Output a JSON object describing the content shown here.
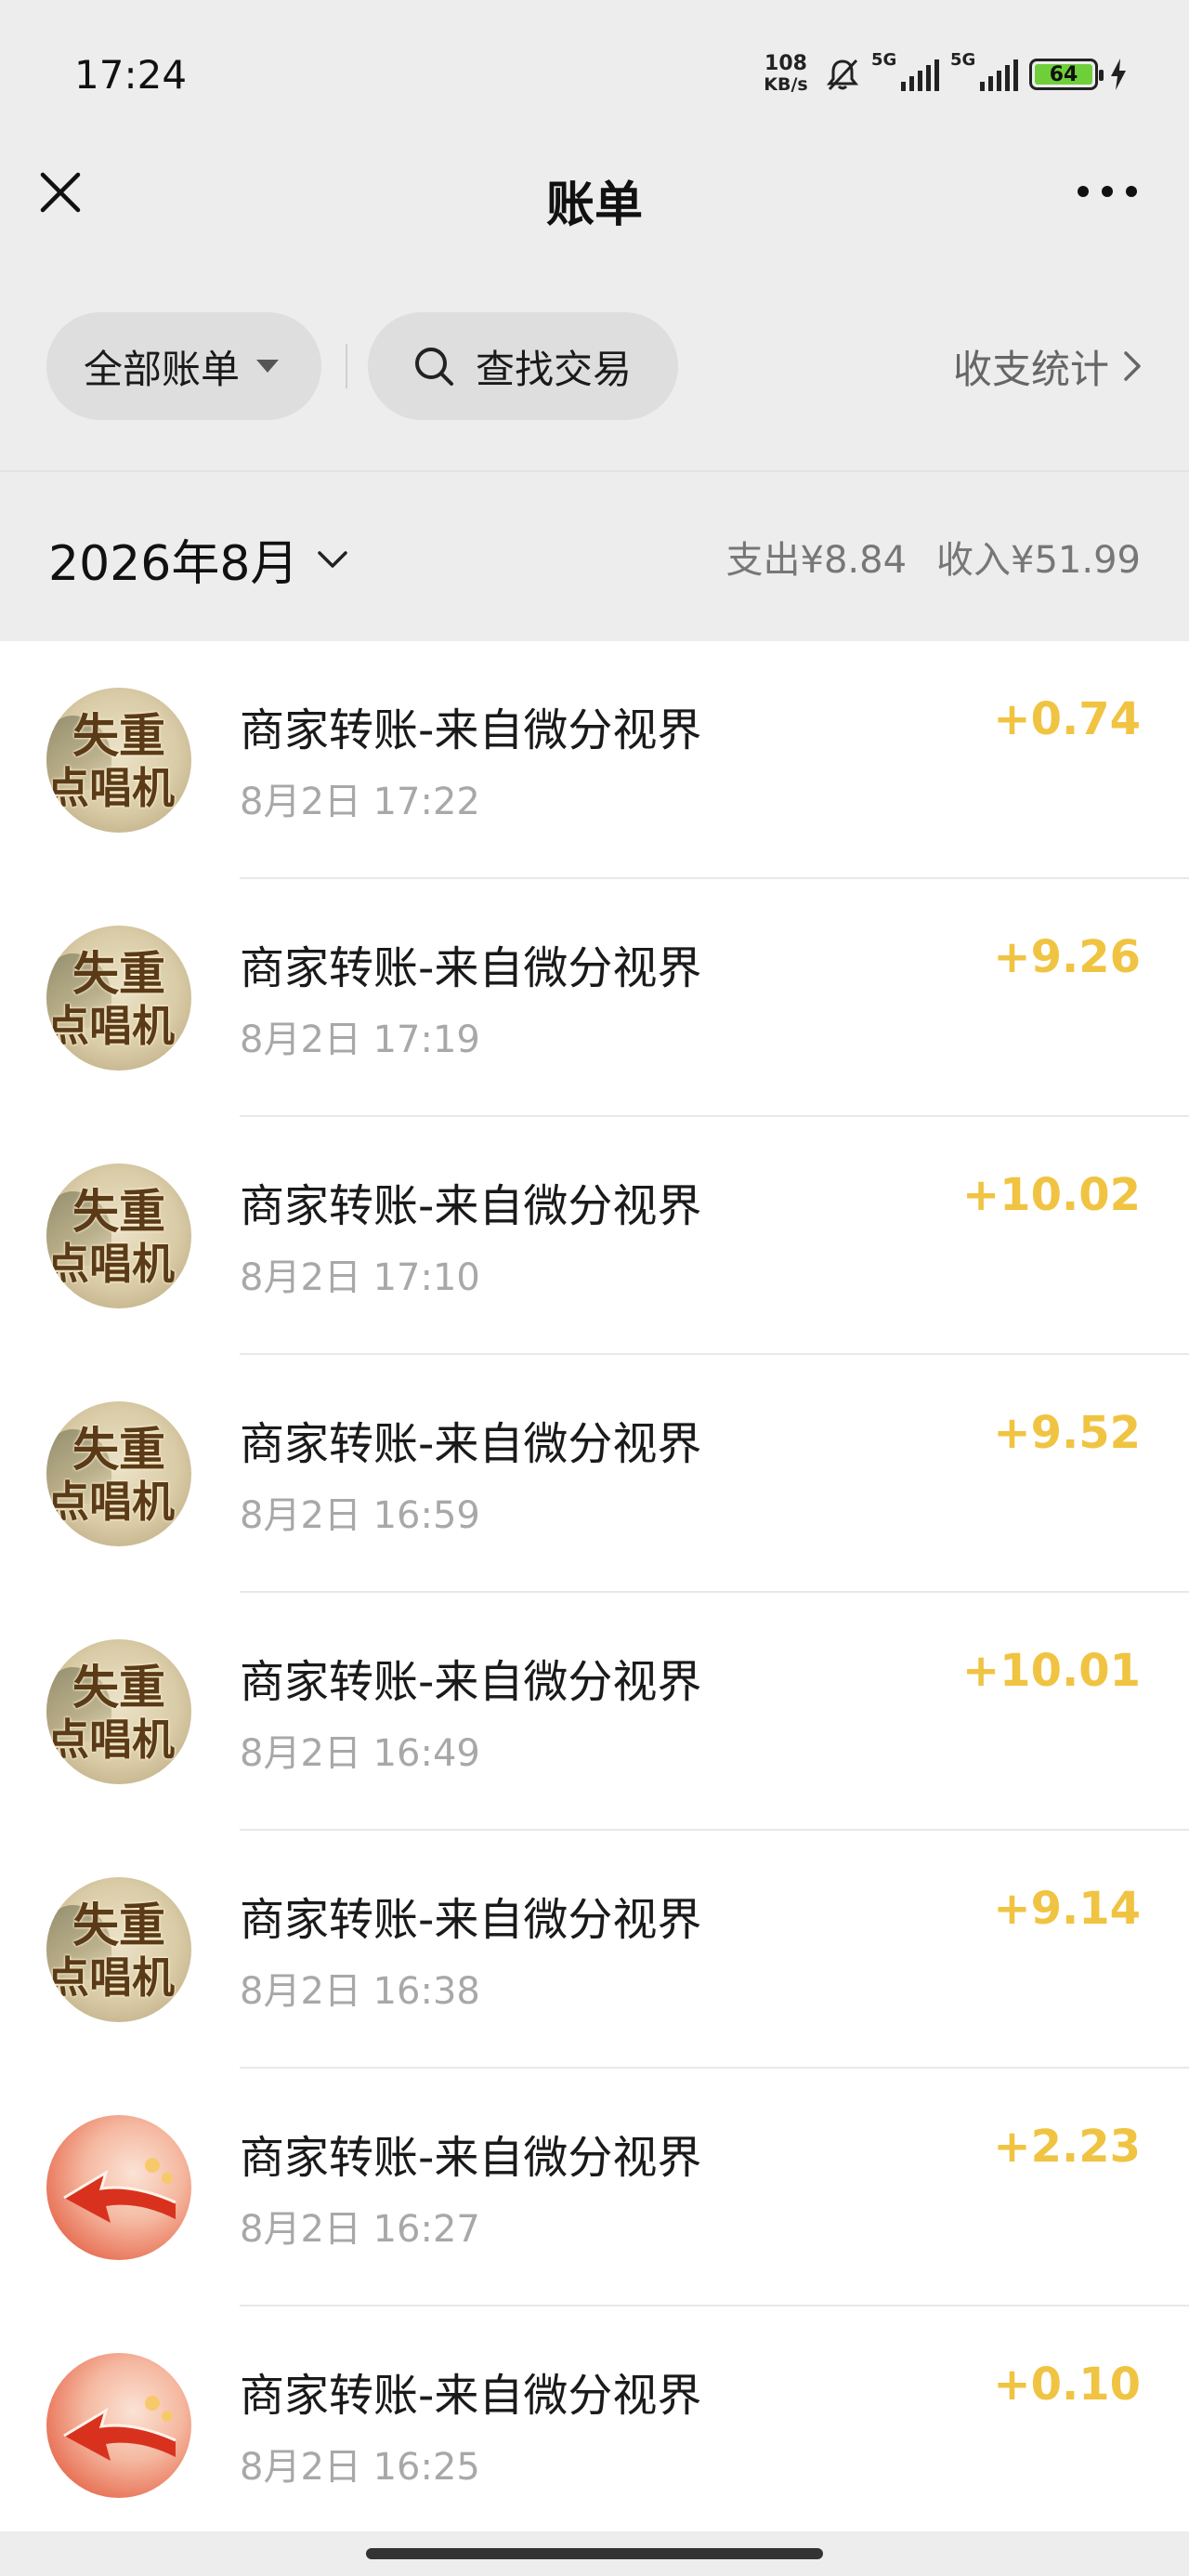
{
  "status_bar": {
    "time": "17:24",
    "net_speed_value": "108",
    "net_speed_unit": "KB/s",
    "sim1_label": "5G",
    "sim2_label": "5G",
    "battery_level": "64",
    "icons": [
      "bell-off-icon",
      "signal-icon",
      "battery-icon",
      "charging-bolt-icon"
    ]
  },
  "header": {
    "title": "账单",
    "close_icon": "close-icon",
    "more_icon": "more-icon"
  },
  "filters": {
    "all_bills_label": "全部账单",
    "search_label": "查找交易",
    "stats_label": "收支统计"
  },
  "month": {
    "label": "2026年8月",
    "expense": "支出¥8.84",
    "income": "收入¥51.99"
  },
  "transactions": [
    {
      "title": "商家转账-来自微分视界",
      "time": "8月2日 17:22",
      "amount": "+0.74",
      "avatar": "poster",
      "avatar_text_1": "失重",
      "avatar_text_2": "点唱机"
    },
    {
      "title": "商家转账-来自微分视界",
      "time": "8月2日 17:19",
      "amount": "+9.26",
      "avatar": "poster",
      "avatar_text_1": "失重",
      "avatar_text_2": "点唱机"
    },
    {
      "title": "商家转账-来自微分视界",
      "time": "8月2日 17:10",
      "amount": "+10.02",
      "avatar": "poster",
      "avatar_text_1": "失重",
      "avatar_text_2": "点唱机"
    },
    {
      "title": "商家转账-来自微分视界",
      "time": "8月2日 16:59",
      "amount": "+9.52",
      "avatar": "poster",
      "avatar_text_1": "失重",
      "avatar_text_2": "点唱机"
    },
    {
      "title": "商家转账-来自微分视界",
      "time": "8月2日 16:49",
      "amount": "+10.01",
      "avatar": "poster",
      "avatar_text_1": "失重",
      "avatar_text_2": "点唱机"
    },
    {
      "title": "商家转账-来自微分视界",
      "time": "8月2日 16:38",
      "amount": "+9.14",
      "avatar": "poster",
      "avatar_text_1": "失重",
      "avatar_text_2": "点唱机"
    },
    {
      "title": "商家转账-来自微分视界",
      "time": "8月2日 16:27",
      "amount": "+2.23",
      "avatar": "arrow"
    },
    {
      "title": "商家转账-来自微分视界",
      "time": "8月2日 16:25",
      "amount": "+0.10",
      "avatar": "arrow"
    }
  ],
  "colors": {
    "background": "#ededed",
    "list_background": "#ffffff",
    "amount": "#f0c442",
    "secondary_text": "#a8a8a8"
  }
}
